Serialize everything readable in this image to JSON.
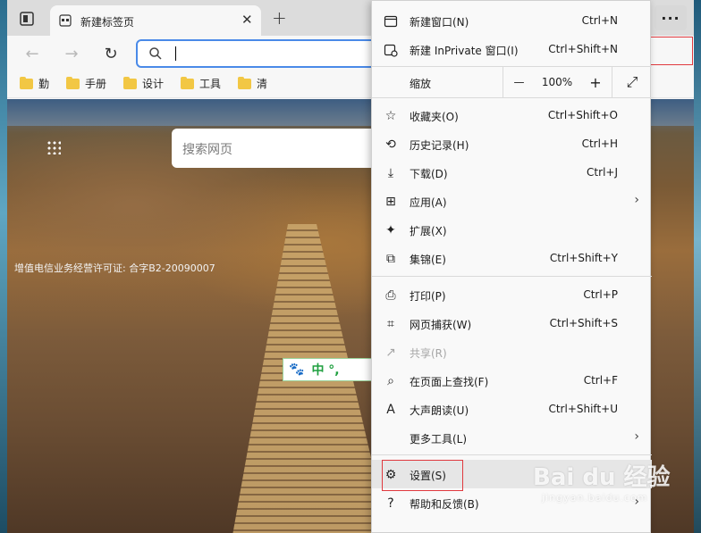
{
  "tab": {
    "title": "新建标签页"
  },
  "favorites": [
    {
      "label": "勤"
    },
    {
      "label": "手册"
    },
    {
      "label": "设计"
    },
    {
      "label": "工具"
    },
    {
      "label": "清"
    }
  ],
  "page": {
    "search_placeholder": "搜索网页",
    "license": "增值电信业务经营许可证: 合字B2-20090007",
    "ime": "中 °,"
  },
  "menu": {
    "more_label": "···",
    "zoom": {
      "label": "缩放",
      "value": "100%",
      "minus": "—",
      "plus": "+"
    },
    "items": [
      {
        "label": "新建窗口(N)",
        "shortcut": "Ctrl+N",
        "icon": "window-icon"
      },
      {
        "label": "新建 InPrivate 窗口(I)",
        "shortcut": "Ctrl+Shift+N",
        "icon": "inprivate-icon"
      },
      {
        "label": "收藏夹(O)",
        "shortcut": "Ctrl+Shift+O",
        "icon": "star-list-icon"
      },
      {
        "label": "历史记录(H)",
        "shortcut": "Ctrl+H",
        "icon": "history-icon"
      },
      {
        "label": "下载(D)",
        "shortcut": "Ctrl+J",
        "icon": "download-icon"
      },
      {
        "label": "应用(A)",
        "shortcut": "",
        "icon": "apps-icon"
      },
      {
        "label": "扩展(X)",
        "shortcut": "",
        "icon": "extension-icon"
      },
      {
        "label": "集锦(E)",
        "shortcut": "Ctrl+Shift+Y",
        "icon": "collections-icon"
      },
      {
        "label": "打印(P)",
        "shortcut": "Ctrl+P",
        "icon": "print-icon"
      },
      {
        "label": "网页捕获(W)",
        "shortcut": "Ctrl+Shift+S",
        "icon": "capture-icon"
      },
      {
        "label": "共享(R)",
        "shortcut": "",
        "icon": "share-icon"
      },
      {
        "label": "在页面上查找(F)",
        "shortcut": "Ctrl+F",
        "icon": "find-icon"
      },
      {
        "label": "大声朗读(U)",
        "shortcut": "Ctrl+Shift+U",
        "icon": "read-aloud-icon"
      },
      {
        "label": "更多工具(L)",
        "shortcut": "",
        "icon": ""
      },
      {
        "label": "设置(S)",
        "shortcut": "",
        "icon": "gear-icon"
      },
      {
        "label": "帮助和反馈(B)",
        "shortcut": "",
        "icon": "help-icon"
      }
    ]
  },
  "watermark": {
    "main": "Bai du 经验",
    "sub": "jingyan.baidu.com"
  },
  "colors": {
    "accent": "#4a8ae8",
    "highlight_box": "#e0393e",
    "menu_bg": "#f9f9f9"
  }
}
